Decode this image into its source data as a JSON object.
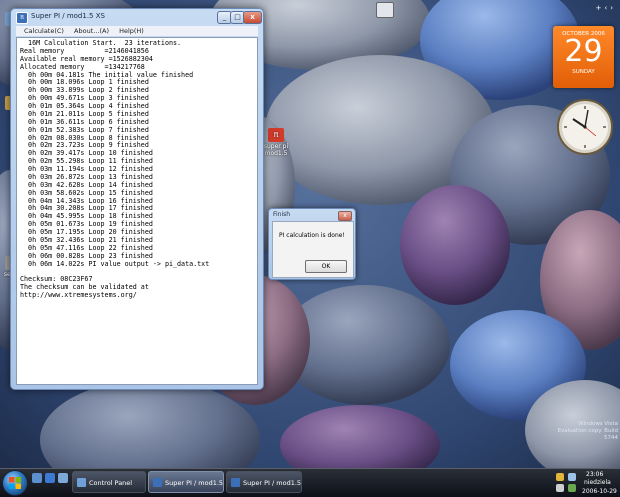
{
  "desktop": {
    "icons": [
      {
        "label": ""
      },
      {
        "label": ""
      },
      {
        "label": "setfsb"
      },
      {
        "label": ""
      },
      {
        "label": "super pi mod1.5"
      }
    ]
  },
  "superpi_window": {
    "title": "Super PI / mod1.5 XS",
    "menu": [
      "Calculate(C)",
      "About...(A)",
      "Help(H)"
    ],
    "console_lines": [
      "  16M Calculation Start.  23 iterations.",
      "Real memory          =2146041856",
      "Available real memory =1526882304",
      "Allocated memory     =134217768",
      "  0h 00m 04.181s The initial value finished",
      "  0h 00m 18.096s Loop 1 finished",
      "  0h 00m 33.899s Loop 2 finished",
      "  0h 00m 49.671s Loop 3 finished",
      "  0h 01m 05.364s Loop 4 finished",
      "  0h 01m 21.011s Loop 5 finished",
      "  0h 01m 36.611s Loop 6 finished",
      "  0h 01m 52.383s Loop 7 finished",
      "  0h 02m 08.030s Loop 8 finished",
      "  0h 02m 23.723s Loop 9 finished",
      "  0h 02m 39.417s Loop 10 finished",
      "  0h 02m 55.298s Loop 11 finished",
      "  0h 03m 11.194s Loop 12 finished",
      "  0h 03m 26.872s Loop 13 finished",
      "  0h 03m 42.628s Loop 14 finished",
      "  0h 03m 58.602s Loop 15 finished",
      "  0h 04m 14.343s Loop 16 finished",
      "  0h 04m 30.208s Loop 17 finished",
      "  0h 04m 45.995s Loop 18 finished",
      "  0h 05m 01.673s Loop 19 finished",
      "  0h 05m 17.195s Loop 20 finished",
      "  0h 05m 32.436s Loop 21 finished",
      "  0h 05m 47.116s Loop 22 finished",
      "  0h 06m 00.828s Loop 23 finished",
      "  0h 06m 14.022s PI value output -> pi_data.txt",
      "",
      "Checksum: 08C23F67",
      "The checksum can be validated at",
      "http://www.xtremesystems.org/"
    ]
  },
  "finish_dialog": {
    "title": "Finish",
    "message": "PI calculation is done!",
    "ok_label": "OK",
    "close_glyph": "x"
  },
  "window_controls": {
    "minimize": "_",
    "maximize": "□",
    "close": "x"
  },
  "calendar_gadget": {
    "month_year": "OCTOBER 2006",
    "day": "29",
    "weekday": "SUNDAY"
  },
  "watermark": {
    "line1": "Windows Vista",
    "line2": "Evaluation copy. Build 5744"
  },
  "taskbar": {
    "tasks": [
      {
        "label": "Control Panel"
      },
      {
        "label": "Super PI / mod1.5 XS"
      },
      {
        "label": "Super PI / mod1.5 XS"
      }
    ],
    "tray": {
      "time": "23:06",
      "day": "niedziela",
      "date": "2006-10-29"
    }
  },
  "colors": {
    "calendar_orange": "#f06a10",
    "taskbar": "#161a22",
    "accent_blue": "#2d7ac4"
  }
}
